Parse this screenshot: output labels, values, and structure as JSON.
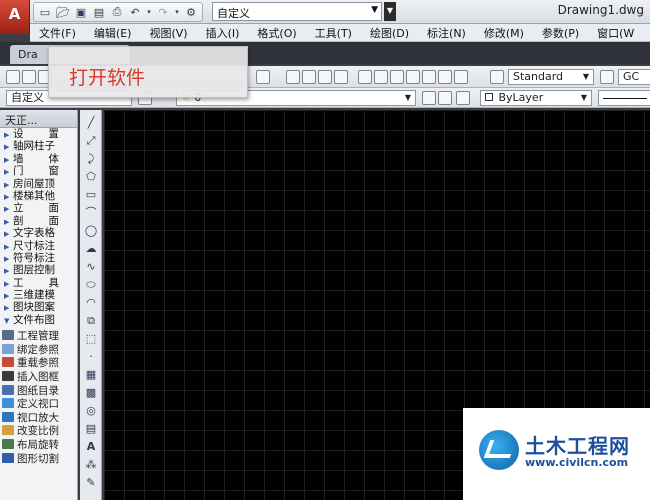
{
  "app": {
    "logo_letter": "A",
    "document_title": "Drawing1.dwg",
    "workspace": "自定义"
  },
  "menu": [
    "文件(F)",
    "编辑(E)",
    "视图(V)",
    "插入(I)",
    "格式(O)",
    "工具(T)",
    "绘图(D)",
    "标注(N)",
    "修改(M)",
    "参数(P)",
    "窗口(W"
  ],
  "tabs": {
    "drawing_tab": "Dra"
  },
  "tooltip": {
    "text": "打开软件"
  },
  "toolbar": {
    "text_style": "Standard",
    "dim_style_partial": "GC",
    "layer_state": "自定义",
    "current_layer": "0",
    "color": "ByLayer"
  },
  "left_panel": {
    "title": "天正...",
    "categories": [
      {
        "a": "设",
        "b": "置"
      },
      {
        "label": "轴网柱子"
      },
      {
        "a": "墙",
        "b": "体"
      },
      {
        "a": "门",
        "b": "窗"
      },
      {
        "label": "房间屋顶"
      },
      {
        "label": "楼梯其他"
      },
      {
        "a": "立",
        "b": "面"
      },
      {
        "a": "剖",
        "b": "面"
      },
      {
        "label": "文字表格"
      },
      {
        "label": "尺寸标注"
      },
      {
        "label": "符号标注"
      },
      {
        "label": "图层控制"
      },
      {
        "a": "工",
        "b": "具"
      },
      {
        "label": "三维建模"
      },
      {
        "label": "图块图案"
      },
      {
        "label": "文件布图"
      }
    ],
    "tools": [
      {
        "label": "工程管理",
        "color": "#5a6b8c"
      },
      {
        "label": "绑定参照",
        "color": "#7aa4d6"
      },
      {
        "label": "重载参照",
        "color": "#c84a3a"
      },
      {
        "label": "插入图框",
        "color": "#3a3a3a"
      },
      {
        "label": "图纸目录",
        "color": "#4a6fb0"
      },
      {
        "label": "定义视口",
        "color": "#3b8fd9"
      },
      {
        "label": "视口放大",
        "color": "#2e78c2"
      },
      {
        "label": "改变比例",
        "color": "#d1a33a"
      },
      {
        "label": "布局旋转",
        "color": "#4a7a4a"
      },
      {
        "label": "图形切割",
        "color": "#2e5fa8"
      }
    ]
  },
  "watermark": {
    "name": "土木工程网",
    "url": "www.civilcn.com"
  },
  "colors": {
    "canvas_bg": "#000000",
    "tooltip_text": "#d83a2a",
    "watermark_blue": "#1e4f9c"
  }
}
